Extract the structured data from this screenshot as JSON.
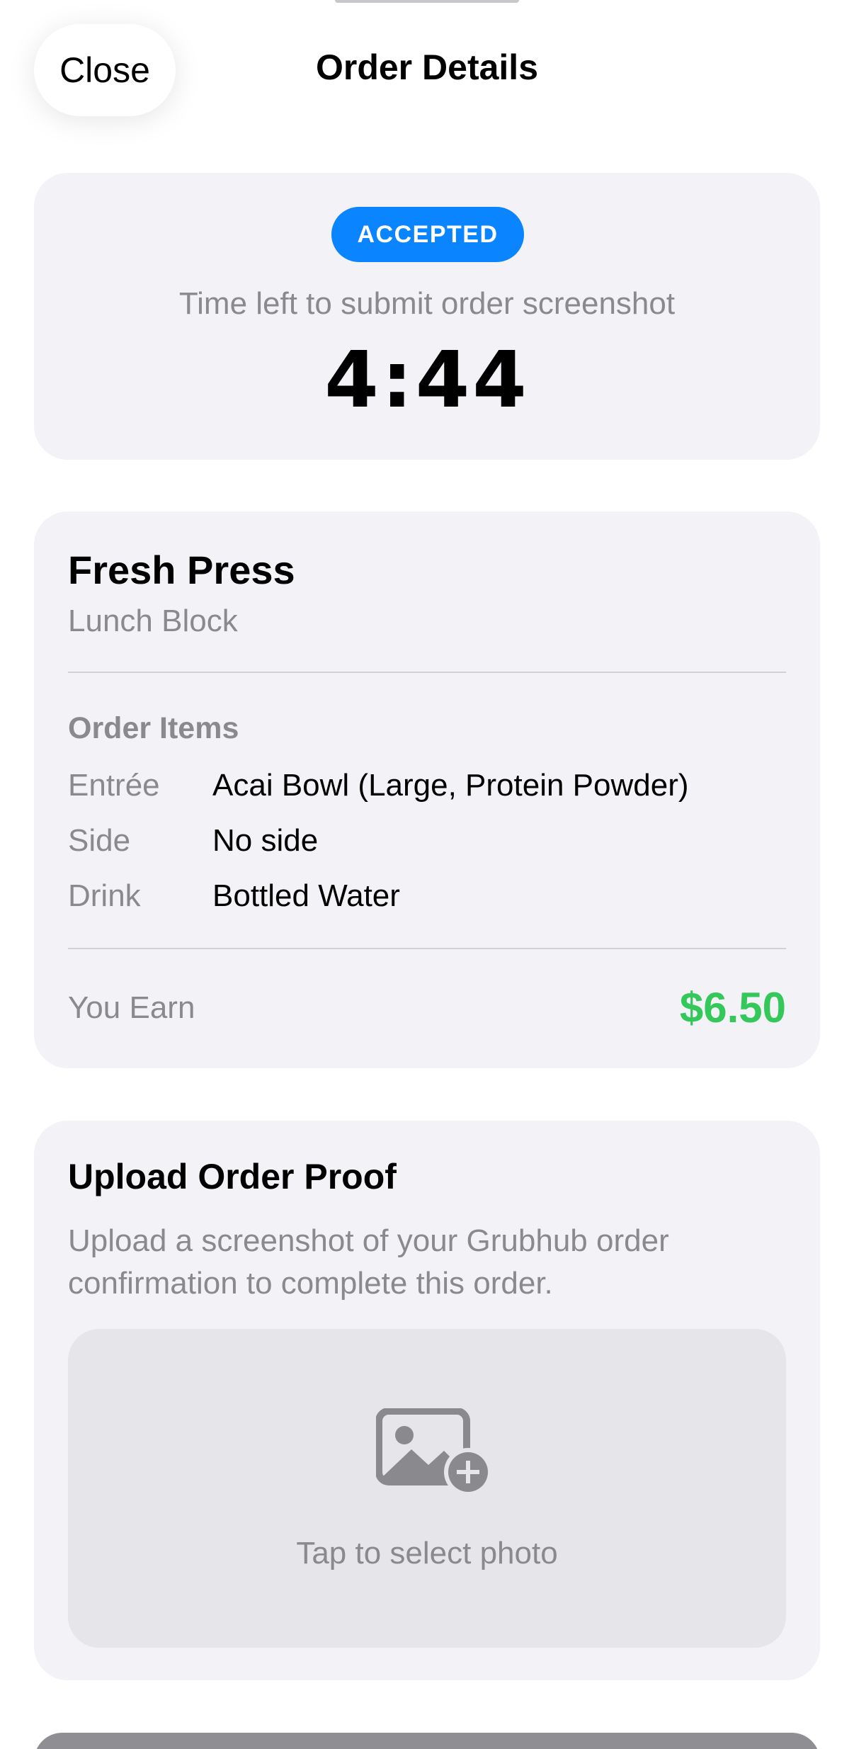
{
  "header": {
    "close_label": "Close",
    "title": "Order Details"
  },
  "status": {
    "badge": "ACCEPTED",
    "badge_color": "#0a84ff",
    "time_label": "Time left to submit order screenshot",
    "timer": "4:44"
  },
  "order": {
    "restaurant": "Fresh Press",
    "block": "Lunch Block",
    "items_title": "Order Items",
    "items": [
      {
        "label": "Entrée",
        "value": "Acai Bowl (Large, Protein Powder)"
      },
      {
        "label": "Side",
        "value": "No side"
      },
      {
        "label": "Drink",
        "value": "Bottled Water"
      }
    ],
    "earn_label": "You Earn",
    "earn_value": "$6.50",
    "earn_color": "#34c759"
  },
  "upload": {
    "title": "Upload Order Proof",
    "description": "Upload a screenshot of your Grubhub order confirmation to complete this order.",
    "picker_icon": "photo-add-icon",
    "picker_label": "Tap to select photo"
  }
}
